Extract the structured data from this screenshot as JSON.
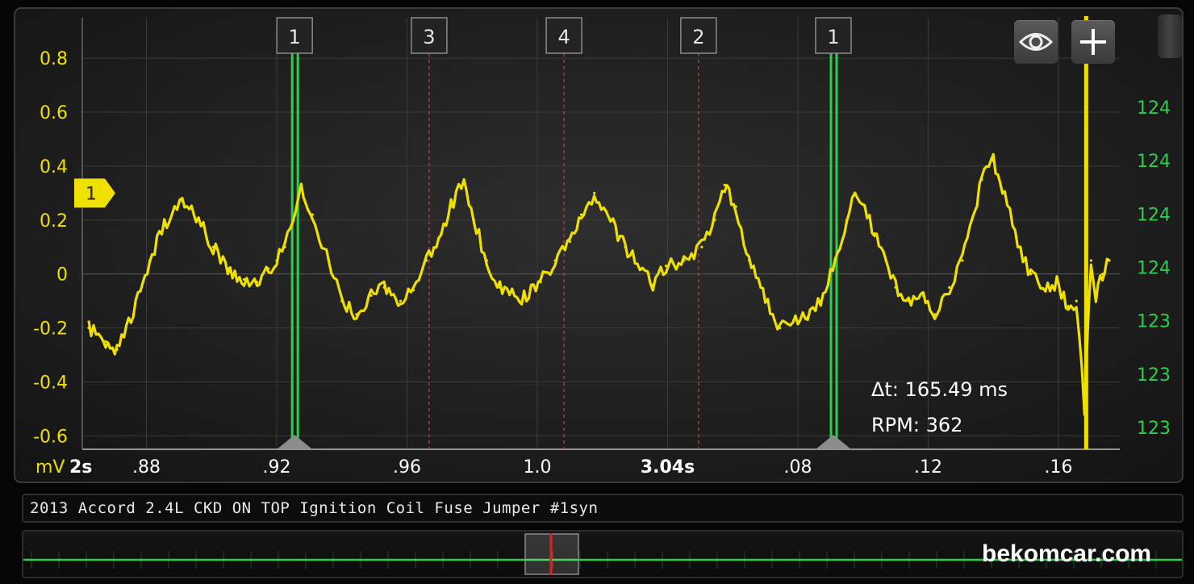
{
  "chart_data": {
    "type": "line",
    "title": "",
    "xlabel": "2s",
    "ylabel": "mV",
    "ylim": [
      -0.65,
      0.95
    ],
    "xlim": [
      2.8623,
      3.1756
    ],
    "y_ticks": [
      {
        "value": 0.8,
        "label": "0.8"
      },
      {
        "value": 0.6,
        "label": "0.6"
      },
      {
        "value": 0.4,
        "label": "0.4"
      },
      {
        "value": 0.2,
        "label": "0.2"
      },
      {
        "value": 0.0,
        "label": "0"
      },
      {
        "value": -0.2,
        "label": "-0.2"
      },
      {
        "value": -0.4,
        "label": "-0.4"
      },
      {
        "value": -0.6,
        "label": "-0.6"
      }
    ],
    "x_ticks": [
      {
        "value": 2.88,
        "label": ".88",
        "bold": false
      },
      {
        "value": 2.92,
        "label": ".92",
        "bold": false
      },
      {
        "value": 2.96,
        "label": ".96",
        "bold": false
      },
      {
        "value": 3.0,
        "label": "1.0",
        "bold": false
      },
      {
        "value": 3.04,
        "label": "3.04s",
        "bold": true
      },
      {
        "value": 3.08,
        "label": ".08",
        "bold": false
      },
      {
        "value": 3.12,
        "label": ".12",
        "bold": false
      },
      {
        "value": 3.16,
        "label": ".16",
        "bold": false
      }
    ],
    "right_axis_labels": [
      "124",
      "124",
      "124",
      "124",
      "123",
      "123",
      "123"
    ],
    "series": [
      {
        "color": "#f0e000",
        "x": [
          2.8623,
          2.8675,
          2.871,
          2.876,
          2.881,
          2.8855,
          2.891,
          2.896,
          2.9005,
          2.905,
          2.91,
          2.914,
          2.9175,
          2.92,
          2.9225,
          2.925,
          2.9275,
          2.931,
          2.936,
          2.94,
          2.9445,
          2.949,
          2.953,
          2.958,
          2.962,
          2.966,
          2.9705,
          2.9735,
          2.9775,
          2.9805,
          2.9845,
          2.9885,
          2.9945,
          3.001,
          3.0055,
          3.01,
          3.0135,
          3.0175,
          3.0225,
          3.027,
          3.0315,
          3.0355,
          3.0395,
          3.045,
          3.0505,
          3.0545,
          3.0575,
          3.061,
          3.065,
          3.07,
          3.0745,
          3.0785,
          3.083,
          3.087,
          3.0915,
          3.095,
          3.0975,
          3.1005,
          3.1035,
          3.107,
          3.11,
          3.114,
          3.1185,
          3.122,
          3.1265,
          3.1305,
          3.1335,
          3.1365,
          3.14,
          3.1435,
          3.1475,
          3.1515,
          3.156,
          3.1595,
          3.163,
          3.1655,
          3.168,
          3.17,
          3.1715,
          3.1735,
          3.1756
        ],
        "y": [
          -0.2,
          -0.25,
          -0.28,
          -0.15,
          0.05,
          0.18,
          0.27,
          0.2,
          0.1,
          0.02,
          -0.02,
          -0.03,
          0.02,
          0.05,
          0.1,
          0.2,
          0.32,
          0.22,
          0.05,
          -0.1,
          -0.15,
          -0.08,
          -0.05,
          -0.1,
          -0.06,
          0.05,
          0.15,
          0.25,
          0.35,
          0.2,
          0.05,
          -0.05,
          -0.1,
          -0.03,
          0.05,
          0.12,
          0.22,
          0.3,
          0.2,
          0.1,
          0.02,
          -0.04,
          0.03,
          0.05,
          0.1,
          0.2,
          0.33,
          0.25,
          0.05,
          -0.1,
          -0.2,
          -0.18,
          -0.16,
          -0.1,
          0.05,
          0.2,
          0.3,
          0.25,
          0.15,
          0.05,
          -0.05,
          -0.1,
          -0.08,
          -0.15,
          -0.05,
          0.05,
          0.2,
          0.35,
          0.42,
          0.3,
          0.1,
          0.0,
          -0.06,
          -0.03,
          -0.12,
          -0.1,
          -0.5,
          0.05,
          -0.08,
          0.0,
          0.05
        ]
      }
    ],
    "markers": [
      {
        "label": "1",
        "x": 2.9255,
        "style": "solid"
      },
      {
        "label": "3",
        "x": 2.9668,
        "style": "dashed"
      },
      {
        "label": "4",
        "x": 3.0082,
        "style": "dashed"
      },
      {
        "label": "2",
        "x": 3.0495,
        "style": "dashed"
      },
      {
        "label": "1",
        "x": 3.0909,
        "style": "solid"
      }
    ],
    "trigger": {
      "label": "1",
      "y": 0.3
    },
    "cursor_x": 3.1685,
    "annotations": [
      "Δt: 165.49 ms",
      "RPM: 362"
    ],
    "colors": {
      "trace": "#f0e000",
      "cursor": "#2ccf4a",
      "right_axis": "#2ccf4a",
      "marker_line": "#d93a3a"
    }
  },
  "caption": "2013 Accord 2.4L CKD ON TOP Ignition Coil Fuse Jumper #1syn",
  "controls": {
    "eye_icon": "eye-icon",
    "plus_icon": "plus-icon"
  },
  "watermark": "bekomcar.com"
}
